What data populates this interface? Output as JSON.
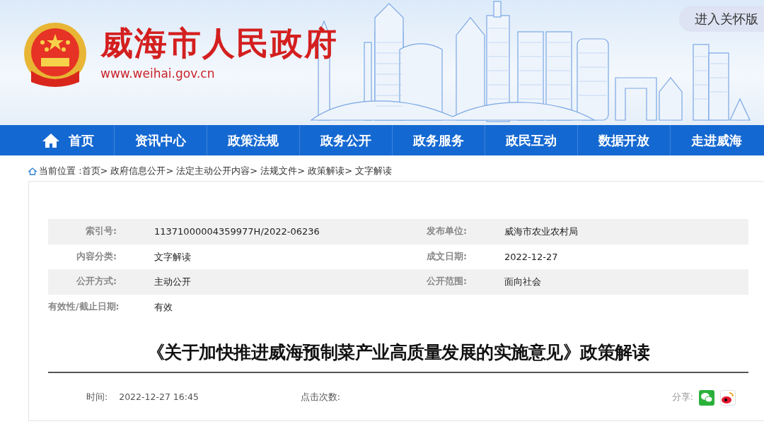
{
  "header": {
    "site_title": "威海市人民政府",
    "site_url": "www.weihai.gov.cn",
    "care_button": "进入关怀版"
  },
  "nav": [
    {
      "label": "首页",
      "selected": false,
      "kind": "home"
    },
    {
      "label": "资讯中心",
      "selected": false,
      "kind": "plain"
    },
    {
      "label": "政策法规",
      "selected": false,
      "kind": "plain"
    },
    {
      "label": "政务公开",
      "selected": false,
      "kind": "plain"
    },
    {
      "label": "政务服务",
      "selected": false,
      "kind": "plain"
    },
    {
      "label": "政民互动",
      "selected": false,
      "kind": "plain"
    },
    {
      "label": "数据开放",
      "selected": false,
      "kind": "plain"
    },
    {
      "label": "走进威海",
      "selected": false,
      "kind": "plain"
    }
  ],
  "breadcrumb": {
    "label": "当前位置 :",
    "items": [
      "首页>",
      "政府信息公开>",
      "法定主动公开内容>",
      "法规文件>",
      "政策解读>",
      "文字解读"
    ]
  },
  "info_table": [
    [
      {
        "label": "索引号:",
        "value": "11371000004359977H/2022-06236"
      },
      {
        "label": "发布单位:",
        "value": "威海市农业农村局"
      }
    ],
    [
      {
        "label": "内容分类:",
        "value": "文字解读"
      },
      {
        "label": "成文日期:",
        "value": "2022-12-27"
      }
    ],
    [
      {
        "label": "公开方式:",
        "value": "主动公开"
      },
      {
        "label": "公开范围:",
        "value": "面向社会"
      }
    ],
    [
      {
        "label": "有效性/截止日期:",
        "value": "有效"
      }
    ]
  ],
  "article": {
    "title": "《关于加快推进威海预制菜产业高质量发展的实施意见》政策解读",
    "time_label": "时间:",
    "time": "2022-12-27 16:45",
    "clicks_label": "点击次数:",
    "share_label": "分享:"
  }
}
